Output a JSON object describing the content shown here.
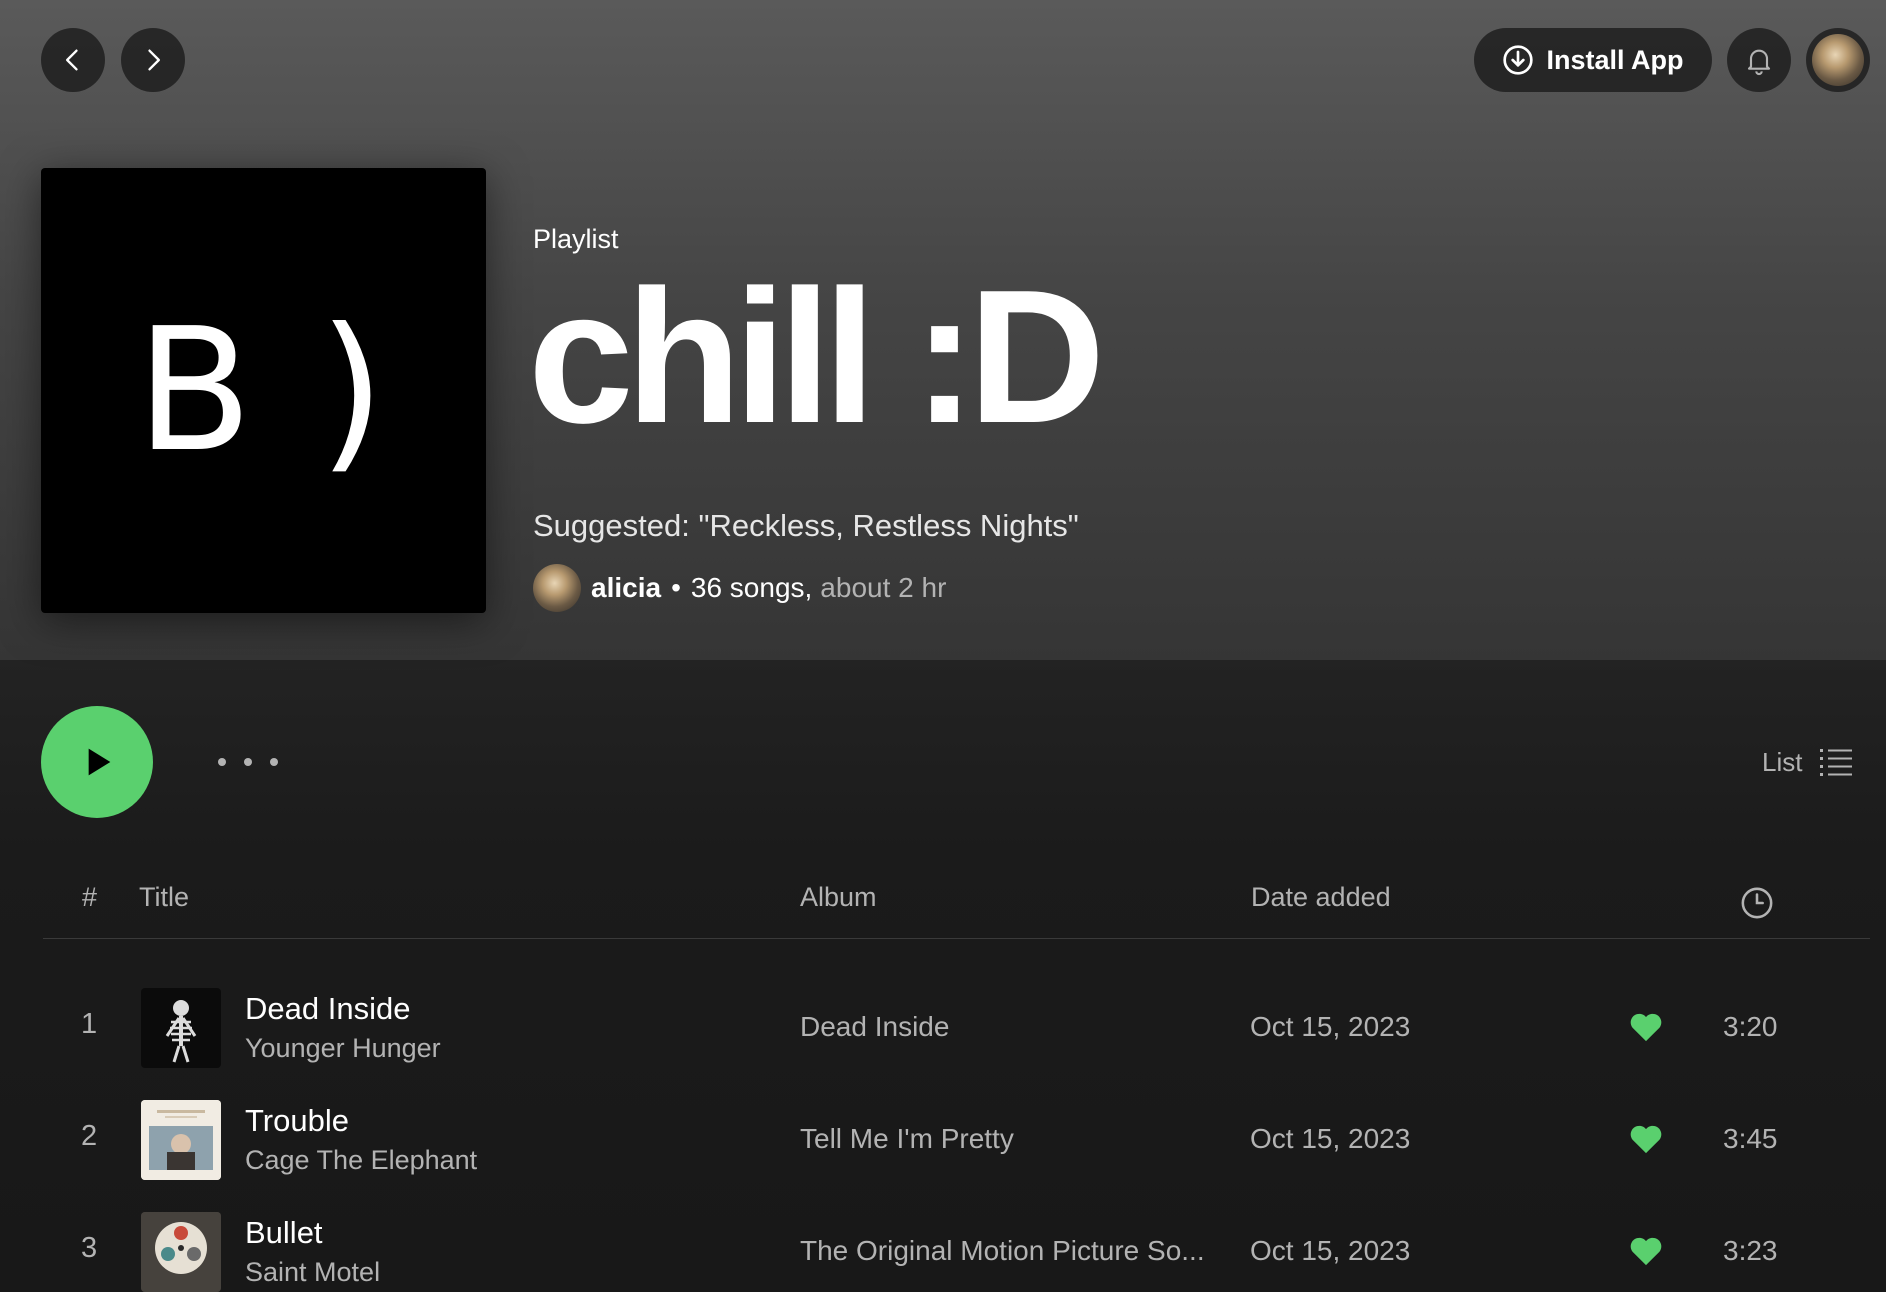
{
  "nav": {
    "back_icon": "chevron-left-icon",
    "forward_icon": "chevron-right-icon",
    "install_label": "Install App",
    "install_icon": "download-circle-icon",
    "bell_icon": "bell-icon"
  },
  "playlist": {
    "type_label": "Playlist",
    "title": "chill :D",
    "cover_text": "B )",
    "description": "Suggested: \"Reckless, Restless Nights\"",
    "owner": "alicia",
    "separator": "•",
    "song_count": "36 songs,",
    "duration": "about 2 hr"
  },
  "actions": {
    "play_icon": "play-icon",
    "more_icon": "more-icon",
    "view_label": "List",
    "view_icon": "list-icon"
  },
  "table": {
    "headers": {
      "number": "#",
      "title": "Title",
      "album": "Album",
      "date_added": "Date added",
      "duration_icon": "clock-icon"
    },
    "rows": [
      {
        "index": "1",
        "title": "Dead Inside",
        "artist": "Younger Hunger",
        "album": "Dead Inside",
        "date_added": "Oct 15, 2023",
        "liked": true,
        "duration": "3:20"
      },
      {
        "index": "2",
        "title": "Trouble",
        "artist": "Cage The Elephant",
        "album": "Tell Me I'm Pretty",
        "date_added": "Oct 15, 2023",
        "liked": true,
        "duration": "3:45"
      },
      {
        "index": "3",
        "title": "Bullet",
        "artist": "Saint Motel",
        "album": "The Original Motion Picture So...",
        "date_added": "Oct 15, 2023",
        "liked": true,
        "duration": "3:23"
      }
    ]
  },
  "colors": {
    "accent_green": "#1ed760",
    "background": "#121212",
    "muted_text": "#b3b3b3"
  }
}
